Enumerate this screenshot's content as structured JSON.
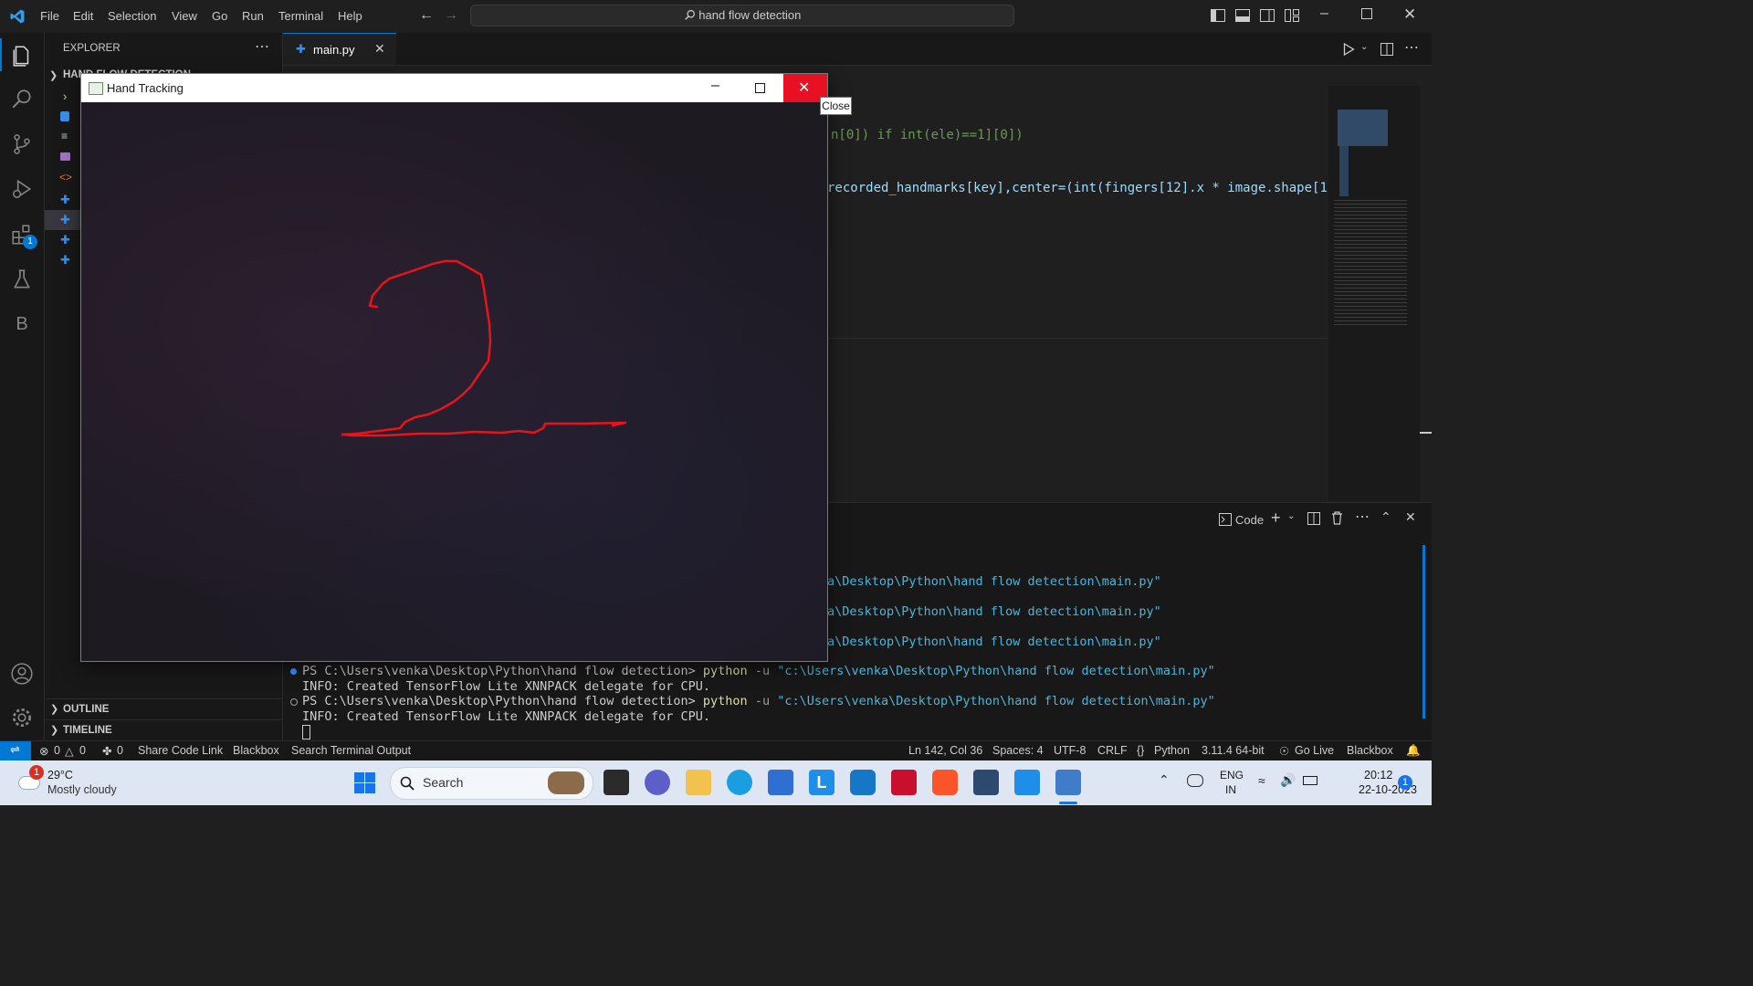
{
  "menu": [
    "File",
    "Edit",
    "Selection",
    "View",
    "Go",
    "Run",
    "Terminal",
    "Help"
  ],
  "command_center": "hand flow detection",
  "sidebar": {
    "title": "EXPLORER",
    "project": "HAND FLOW DETECTION",
    "outline": "OUTLINE",
    "timeline": "TIMELINE"
  },
  "editor": {
    "tab": "main.py",
    "code_lines": [
      "n[0]) if int(ele)==1][0])",
      "recorded_handmarks[key],center=(int(fingers[12].x * image.shape[1]), i"
    ]
  },
  "panel": {
    "new_terminal_label": "Code",
    "history_cmd_tail": "a\\Desktop\\Python\\hand flow detection\\main.py\"",
    "lines": [
      {
        "prompt": "PS C:\\Users\\venka\\Desktop\\Python\\hand flow detection> ",
        "cmd": "python",
        "flag": " -u ",
        "arg": "\"c:\\Users\\venka\\Desktop\\Python\\hand flow detection\\main.py\""
      },
      {
        "text": "INFO: Created TensorFlow Lite XNNPACK delegate for CPU."
      },
      {
        "prompt": "PS C:\\Users\\venka\\Desktop\\Python\\hand flow detection> ",
        "cmd": "python",
        "flag": " -u ",
        "arg": "\"c:\\Users\\venka\\Desktop\\Python\\hand flow detection\\main.py\""
      },
      {
        "text": "INFO: Created TensorFlow Lite XNNPACK delegate for CPU."
      }
    ]
  },
  "statusbar": {
    "errors": "0",
    "warnings": "0",
    "ports": "0",
    "share": "Share Code Link",
    "blackbox": "Blackbox",
    "search_terminal": "Search Terminal Output",
    "position": "Ln 142, Col 36",
    "spaces": "Spaces: 4",
    "encoding": "UTF-8",
    "eol": "CRLF",
    "language": "Python",
    "interpreter": "3.11.4 64-bit",
    "golive": "Go Live",
    "blackbox2": "Blackbox"
  },
  "hand_window": {
    "title": "Hand Tracking",
    "tooltip": "Close",
    "stroke_color": "#e8141a"
  },
  "taskbar": {
    "temp": "29°C",
    "weather": "Mostly cloudy",
    "weather_badge": "1",
    "search": "Search",
    "lang1": "ENG",
    "lang2": "IN",
    "time": "20:12",
    "date": "22-10-2023",
    "notif": "1"
  },
  "badges": {
    "extensions": "1"
  },
  "colors": {
    "accent": "#0078d4",
    "status_remote": "#0078d4",
    "taskbar": "#dde6f2"
  }
}
